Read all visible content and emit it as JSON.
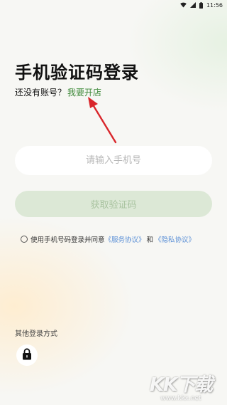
{
  "status_bar": {
    "time": "11:56",
    "icons": [
      "wifi-icon",
      "signal-icon",
      "battery-icon"
    ]
  },
  "login": {
    "title": "手机验证码登录",
    "no_account_text": "还没有账号？",
    "open_store_link": "我要开店",
    "phone_placeholder": "请输入手机号",
    "phone_value": "",
    "get_code_button": "获取验证码",
    "agreement": {
      "prefix": "使用手机号码登录并同意",
      "service_link": "《服务协议》",
      "and_text": "和",
      "privacy_link": "《隐私协议》",
      "checked": false
    },
    "other_login_label": "其他登录方式",
    "other_login_icons": [
      "lock-icon"
    ]
  },
  "watermark": {
    "logo": "KK下载",
    "url": "www.kkx.net"
  },
  "colors": {
    "link_green": "#3f8a3a",
    "button_bg": "#dce8d6",
    "button_text": "#a9c3a0",
    "agreement_link": "#5a8fd6",
    "annotation_arrow": "#d9262b"
  }
}
